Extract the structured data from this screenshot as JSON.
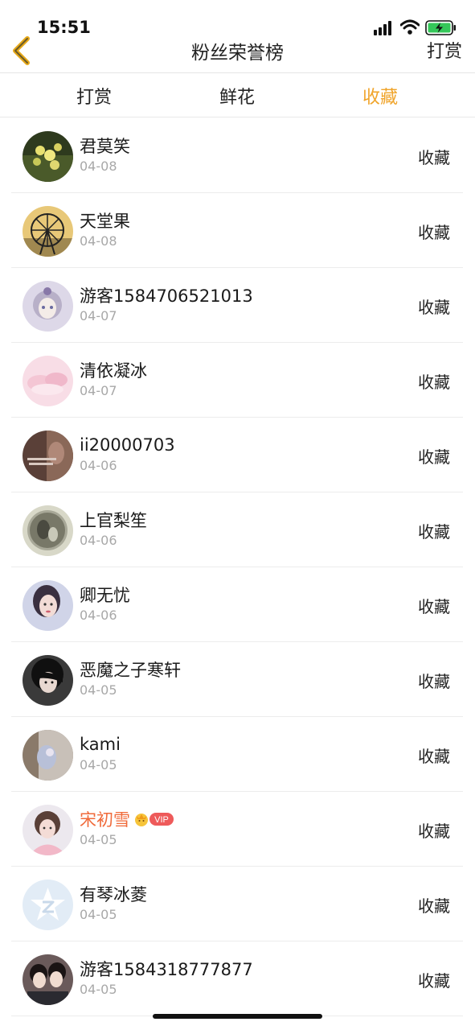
{
  "status": {
    "time": "15:51"
  },
  "nav": {
    "title": "粉丝荣誉榜",
    "right_label": "打赏"
  },
  "tabs": [
    {
      "label": "打赏",
      "active": false
    },
    {
      "label": "鲜花",
      "active": false
    },
    {
      "label": "收藏",
      "active": true
    }
  ],
  "list": [
    {
      "name": "君莫笑",
      "date": "04-08",
      "action": "收藏",
      "avatar": "flowers"
    },
    {
      "name": "天堂果",
      "date": "04-08",
      "action": "收藏",
      "avatar": "ferris-wheel"
    },
    {
      "name": "游客1584706521013",
      "date": "04-07",
      "action": "收藏",
      "avatar": "anime-girl"
    },
    {
      "name": "清依凝冰",
      "date": "04-07",
      "action": "收藏",
      "avatar": "pink-clouds"
    },
    {
      "name": "ii20000703",
      "date": "04-06",
      "action": "收藏",
      "avatar": "dark-photo"
    },
    {
      "name": "上官梨笙",
      "date": "04-06",
      "action": "收藏",
      "avatar": "painting"
    },
    {
      "name": "卿无忧",
      "date": "04-06",
      "action": "收藏",
      "avatar": "woman-portrait"
    },
    {
      "name": "恶魔之子寒轩",
      "date": "04-05",
      "action": "收藏",
      "avatar": "dark-hair"
    },
    {
      "name": "kami",
      "date": "04-05",
      "action": "收藏",
      "avatar": "hand"
    },
    {
      "name": "宋初雪",
      "date": "04-05",
      "action": "收藏",
      "avatar": "pink-girl",
      "vip": true,
      "vip_label": "VIP"
    },
    {
      "name": "有琴冰菱",
      "date": "04-05",
      "action": "收藏",
      "avatar": "default-star"
    },
    {
      "name": "游客1584318777877",
      "date": "04-05",
      "action": "收藏",
      "avatar": "two-men"
    }
  ],
  "colors": {
    "accent": "#f0a42a",
    "vip_name": "#f06a3a",
    "date": "#a8a8a8"
  }
}
